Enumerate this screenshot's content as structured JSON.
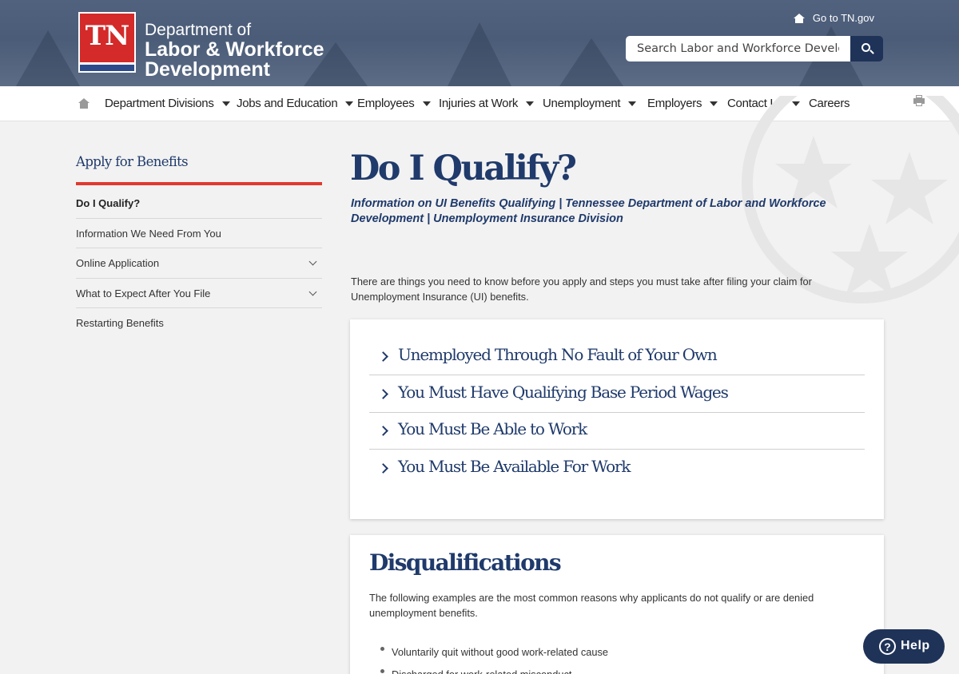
{
  "header": {
    "logo_mark": "TN",
    "logo_line1": "Department of",
    "logo_line2": "Labor & Workforce",
    "logo_line3": "Development",
    "goto_link": "Go to TN.gov",
    "search_placeholder": "Search Labor and Workforce Developm"
  },
  "nav": {
    "items": [
      {
        "label": "Department Divisions",
        "has_dropdown": true
      },
      {
        "label": "Jobs and Education",
        "has_dropdown": true
      },
      {
        "label": "Employees",
        "has_dropdown": true
      },
      {
        "label": "Injuries at Work",
        "has_dropdown": true
      },
      {
        "label": "Unemployment",
        "has_dropdown": true
      },
      {
        "label": "Employers",
        "has_dropdown": true
      },
      {
        "label": "Contact Us",
        "has_dropdown": true
      },
      {
        "label": "Careers",
        "has_dropdown": false
      }
    ]
  },
  "sidebar": {
    "title": "Apply for Benefits",
    "items": [
      {
        "label": "Do I Qualify?",
        "active": true,
        "expandable": false
      },
      {
        "label": "Information We Need From You",
        "active": false,
        "expandable": false
      },
      {
        "label": "Online Application",
        "active": false,
        "expandable": true
      },
      {
        "label": "What to Expect After You File",
        "active": false,
        "expandable": true
      },
      {
        "label": "Restarting Benefits",
        "active": false,
        "expandable": false
      }
    ]
  },
  "main": {
    "title": "Do I Qualify?",
    "subtitle": "Information on UI Benefits Qualifying | Tennessee Department of Labor and Workforce Development | Unemployment Insurance Division",
    "intro": "There are things you need to know before you apply and steps you must take after filing your claim for Unemployment Insurance (UI) benefits.",
    "accordion": [
      "Unemployed Through No Fault of Your Own",
      "You Must Have Qualifying Base Period Wages",
      "You Must Be Able to Work",
      "You Must Be Available For Work"
    ],
    "disqualifications": {
      "heading": "Disqualifications",
      "text": "The following examples are the most common reasons why applicants do not qualify or are denied unemployment benefits.",
      "items": [
        "Voluntarily quit without good work-related cause",
        "Discharged for work-related misconduct"
      ]
    }
  },
  "help_button": "Help",
  "colors": {
    "navy": "#1f3a6b",
    "accent_red": "#e03a2f",
    "header_bg": "#4b5c78",
    "button_dark": "#1f3358"
  }
}
